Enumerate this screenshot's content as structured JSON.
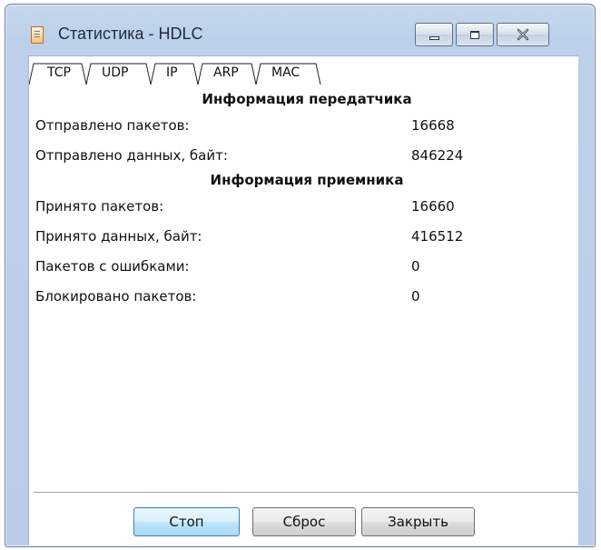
{
  "window": {
    "title": "Статистика - HDLC",
    "icon": "document-icon"
  },
  "tabs": [
    {
      "label": "TCP",
      "active": true
    },
    {
      "label": "UDP",
      "active": false
    },
    {
      "label": "IP",
      "active": false
    },
    {
      "label": "ARP",
      "active": false
    },
    {
      "label": "MAC",
      "active": false
    }
  ],
  "transmitter": {
    "heading": "Информация передатчика",
    "rows": [
      {
        "label": "Отправлено пакетов:",
        "value": "16668"
      },
      {
        "label": "Отправлено данных, байт:",
        "value": "846224"
      }
    ]
  },
  "receiver": {
    "heading": "Информация приемника",
    "rows": [
      {
        "label": "Принято пакетов:",
        "value": "16660"
      },
      {
        "label": "Принято данных, байт:",
        "value": "416512"
      },
      {
        "label": "Пакетов с ошибками:",
        "value": "0"
      },
      {
        "label": "Блокировано пакетов:",
        "value": "0"
      }
    ]
  },
  "buttons": {
    "stop": "Стоп",
    "reset": "Сброс",
    "close": "Закрыть"
  }
}
